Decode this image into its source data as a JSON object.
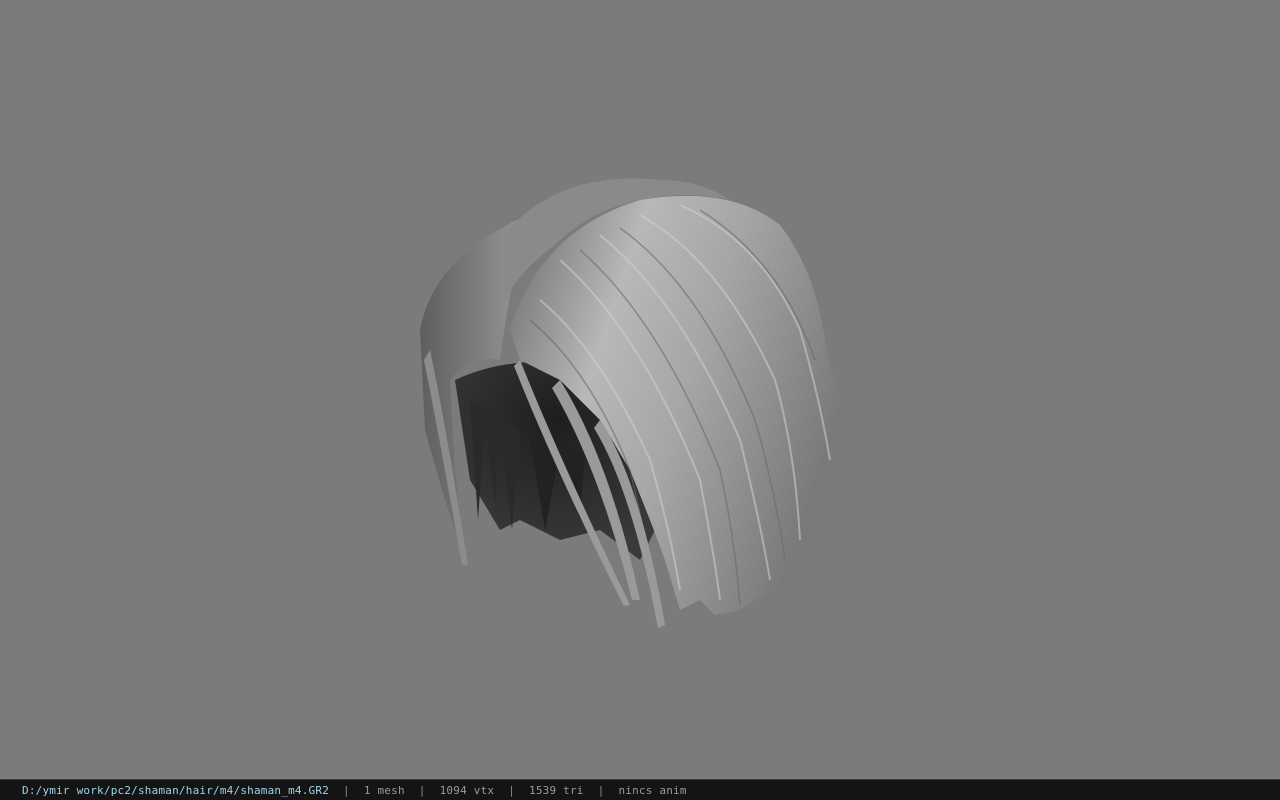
{
  "viewport": {
    "background": "#7b7b7b",
    "model": "3D hair mesh (gray shaded)"
  },
  "statusbar": {
    "file_path": "D:/ymir work/pc2/shaman/hair/m4/shaman_m4.GR2",
    "separator": "|",
    "mesh_count": "1 mesh",
    "vertex_count": "1094 vtx",
    "triangle_count": "1539 tri",
    "anim_status": "nincs anim",
    "path_color": "#9fd2e8",
    "text_color": "#9a9a9a",
    "background": "#141414"
  }
}
